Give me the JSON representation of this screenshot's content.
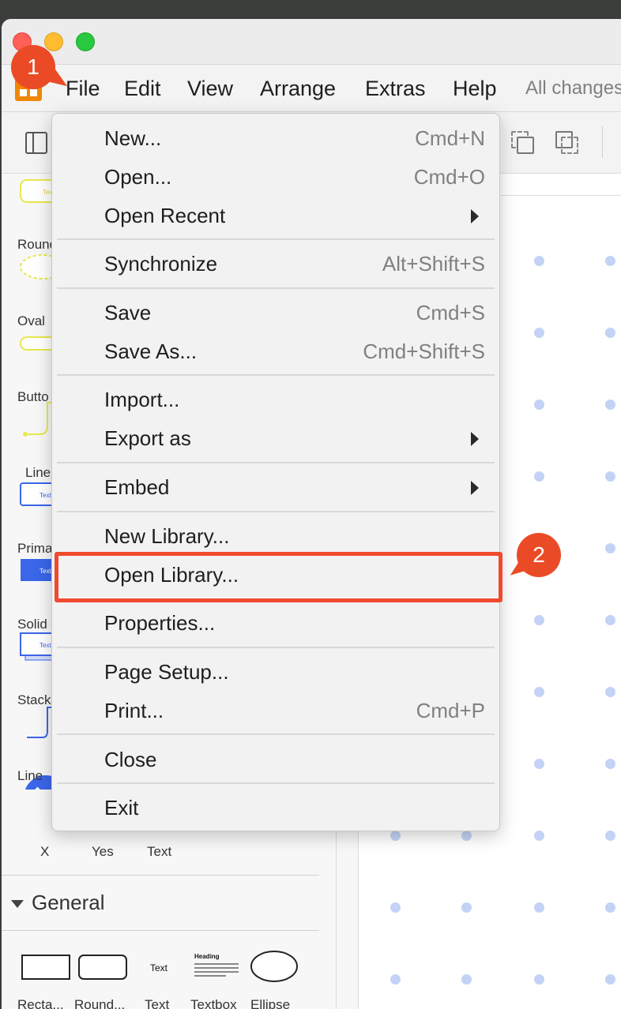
{
  "menubar": {
    "items": [
      "File",
      "Edit",
      "View",
      "Arrange",
      "Extras",
      "Help"
    ],
    "status": "All changes"
  },
  "sidebar": {
    "shapes": [
      "Round",
      "Oval",
      "Butto",
      "Line",
      "Prima",
      "Solid",
      "Stack",
      "Line",
      "X",
      "Yes",
      "Text"
    ],
    "shape_text": "Text",
    "section_title": "General",
    "general_shapes": [
      "Recta...",
      "Round...",
      "Text",
      "Textbox",
      "Ellipse"
    ],
    "textbox_heading": "Heading"
  },
  "file_menu": {
    "items": [
      {
        "label": "New...",
        "shortcut": "Cmd+N"
      },
      {
        "label": "Open...",
        "shortcut": "Cmd+O"
      },
      {
        "label": "Open Recent",
        "submenu": true
      },
      {
        "label": "Synchronize",
        "shortcut": "Alt+Shift+S"
      },
      {
        "label": "Save",
        "shortcut": "Cmd+S"
      },
      {
        "label": "Save As...",
        "shortcut": "Cmd+Shift+S"
      },
      {
        "label": "Import..."
      },
      {
        "label": "Export as",
        "submenu": true
      },
      {
        "label": "Embed",
        "submenu": true
      },
      {
        "label": "New Library..."
      },
      {
        "label": "Open Library...",
        "highlighted": true
      },
      {
        "label": "Properties..."
      },
      {
        "label": "Page Setup..."
      },
      {
        "label": "Print...",
        "shortcut": "Cmd+P"
      },
      {
        "label": "Close"
      },
      {
        "label": "Exit"
      }
    ]
  },
  "callouts": {
    "step1": "1",
    "step2": "2"
  },
  "colors": {
    "accent": "#ea4b26",
    "highlight_border": "#f04a2f",
    "app_logo": "#f08705",
    "grid_dot": "#c3d3f5"
  }
}
